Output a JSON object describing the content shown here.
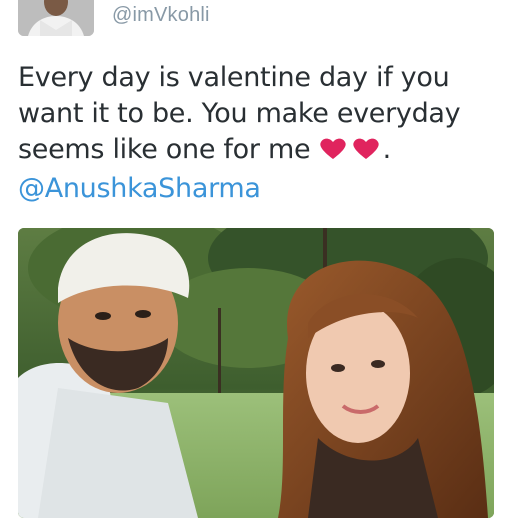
{
  "tweet": {
    "handle": "@imVkohli",
    "text_line1": "Every day is valentine day if you",
    "text_line2": "want it to be. You make everyday",
    "text_line3": "seems like one for me",
    "text_line3_end": ".",
    "mention": "@AnushkaSharma",
    "emoji": "heart-icon",
    "emoji_color": "#e0245e"
  },
  "colors": {
    "handle": "#8899a6",
    "text": "#292f33",
    "link": "#3b94d9"
  }
}
